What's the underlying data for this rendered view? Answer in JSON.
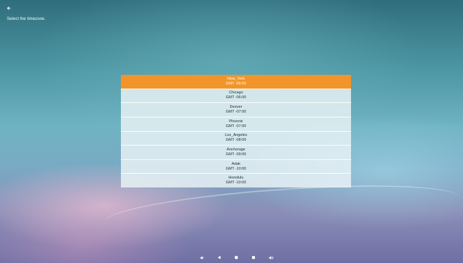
{
  "header": {
    "back_icon": "back-arrow-icon",
    "prompt": "Select the timezone."
  },
  "timezones": [
    {
      "name": "New_York",
      "offset": "GMT -05:00",
      "selected": true
    },
    {
      "name": "Chicago",
      "offset": "GMT -06:00",
      "selected": false
    },
    {
      "name": "Denver",
      "offset": "GMT -07:00",
      "selected": false
    },
    {
      "name": "Phoenix",
      "offset": "GMT -07:00",
      "selected": false
    },
    {
      "name": "Los_Angeles",
      "offset": "GMT -08:00",
      "selected": false
    },
    {
      "name": "Anchorage",
      "offset": "GMT -09:00",
      "selected": false
    },
    {
      "name": "Adak",
      "offset": "GMT -10:00",
      "selected": false
    },
    {
      "name": "Honolulu",
      "offset": "GMT -10:00",
      "selected": false
    }
  ],
  "navbar": {
    "icons": [
      "volume-down-icon",
      "back-triangle-icon",
      "home-circle-icon",
      "recents-square-icon",
      "volume-up-icon"
    ]
  },
  "colors": {
    "selected": "#f1952a",
    "item_background": "#ecf4f7"
  }
}
